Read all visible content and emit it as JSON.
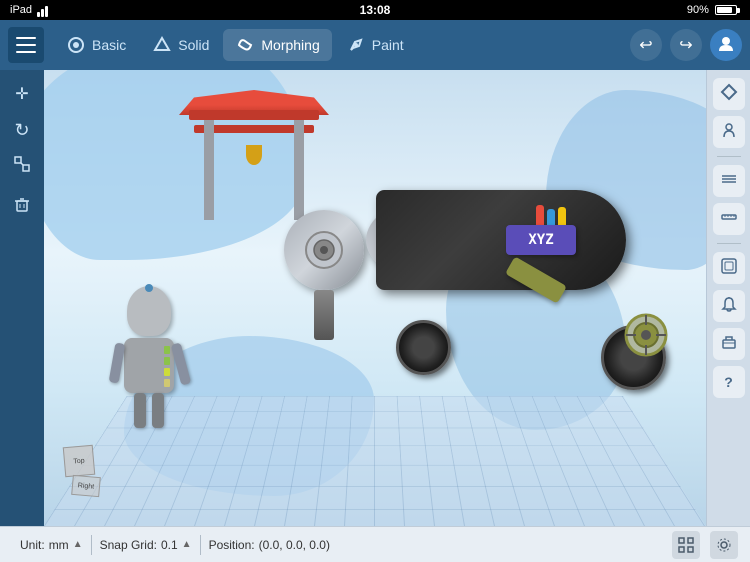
{
  "statusBar": {
    "left": "iPad",
    "time": "13:08",
    "battery": "90%"
  },
  "toolbar": {
    "tabs": [
      {
        "id": "basic",
        "label": "Basic",
        "active": false
      },
      {
        "id": "solid",
        "label": "Solid",
        "active": false
      },
      {
        "id": "morphing",
        "label": "Morphing",
        "active": true
      },
      {
        "id": "paint",
        "label": "Paint",
        "active": false
      }
    ],
    "undoLabel": "↩",
    "redoLabel": "↪"
  },
  "leftTools": [
    {
      "id": "move",
      "icon": "✛"
    },
    {
      "id": "rotate",
      "icon": "↻"
    },
    {
      "id": "scale",
      "icon": "⤡"
    },
    {
      "id": "delete",
      "icon": "🗑"
    }
  ],
  "rightSidebar": [
    {
      "id": "shape",
      "icon": "⬡"
    },
    {
      "id": "figure",
      "icon": "👤"
    },
    {
      "id": "layers",
      "icon": "≡"
    },
    {
      "id": "ruler",
      "icon": "📏"
    },
    {
      "id": "transform",
      "icon": "⊡"
    },
    {
      "id": "notification",
      "icon": "🔔"
    },
    {
      "id": "box",
      "icon": "📦"
    },
    {
      "id": "help",
      "icon": "?"
    }
  ],
  "bottomBar": {
    "unitLabel": "Unit:",
    "unitValue": "mm",
    "snapLabel": "Snap Grid:",
    "snapValue": "0.1",
    "positionLabel": "Position:",
    "positionValue": "(0.0, 0.0, 0.0)"
  },
  "viewport": {
    "vehicleLabel": "XYZ"
  },
  "axes": {
    "topLabel": "Top",
    "rightLabel": "Right"
  }
}
